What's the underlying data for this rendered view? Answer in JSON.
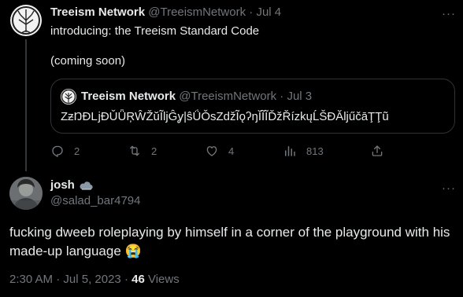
{
  "tweet": {
    "author_name": "Treeism Network",
    "author_handle": "@TreeismNetwork",
    "separator": "·",
    "date": "Jul 4",
    "text_line1": "introducing: the Treeism Standard Code",
    "text_line2": "(coming soon)",
    "more": "···",
    "quote": {
      "author_name": "Treeism Network",
      "author_handle": "@TreeismNetwork",
      "separator": "·",
      "date": "Jul 3",
      "text": "ZƶŊĐǈĐǓǕŖŴŽŭĨljĜỿ|ŝǗǑsZdžĨǫʔŋĬĨĨĎžŘízkųĹŠĐĂljűčāŢŢũ"
    },
    "actions": {
      "reply_count": "2",
      "retweet_count": "2",
      "like_count": "4",
      "views_count": "813"
    }
  },
  "reply": {
    "author_name": "josh",
    "author_handle": "@salad_bar4794",
    "text": "fucking dweeb roleplaying by himself in a corner of the playground with his made-up language 😭",
    "more": "···",
    "time": "2:30 AM",
    "separator": "·",
    "date": "Jul 5, 2023",
    "views_count": "46",
    "views_label": "Views"
  },
  "colors": {
    "background": "#000000",
    "text": "#e7e9ea",
    "muted": "#71767b",
    "border": "#2f3336"
  },
  "icons": {
    "reply": "reply-icon",
    "retweet": "retweet-icon",
    "like": "heart-icon",
    "views": "views-icon",
    "share": "share-icon",
    "name_badge": "cloud-icon"
  }
}
